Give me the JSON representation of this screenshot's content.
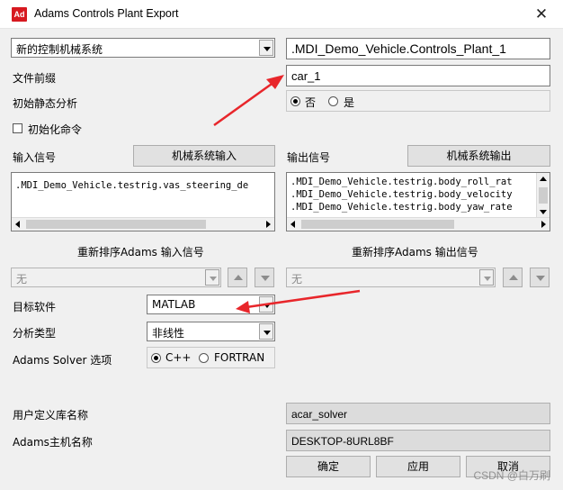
{
  "window": {
    "title": "Adams Controls Plant Export",
    "icon_text": "Ad",
    "close_glyph": "✕"
  },
  "plant_select": {
    "value": "新的控制机械系统"
  },
  "plant_name": {
    "value": ".MDI_Demo_Vehicle.Controls_Plant_1"
  },
  "file_prefix": {
    "label": "文件前缀",
    "value": "car_1"
  },
  "initial_static": {
    "label": "初始静态分析",
    "options": [
      "否",
      "是"
    ],
    "selected": "否"
  },
  "init_command": {
    "label": "初始化命令",
    "checked": false
  },
  "inputs": {
    "label": "输入信号",
    "button_label": "机械系统输入",
    "items": [
      ".MDI_Demo_Vehicle.testrig.vas_steering_de"
    ],
    "reorder_label": "重新排序Adams 输入信号",
    "reorder_value": "无"
  },
  "outputs": {
    "label": "输出信号",
    "button_label": "机械系统输出",
    "items": [
      ".MDI_Demo_Vehicle.testrig.body_roll_rat",
      ".MDI_Demo_Vehicle.testrig.body_velocity",
      ".MDI_Demo_Vehicle.testrig.body_yaw_rate"
    ],
    "reorder_label": "重新排序Adams 输出信号",
    "reorder_value": "无"
  },
  "target_software": {
    "label": "目标软件",
    "value": "MATLAB"
  },
  "analysis_type": {
    "label": "分析类型",
    "value": "非线性"
  },
  "solver": {
    "label": "Adams Solver 选项",
    "options": [
      "C++",
      "FORTRAN"
    ],
    "selected": "C++"
  },
  "user_lib": {
    "label": "用户定义库名称",
    "value": "acar_solver"
  },
  "host": {
    "label": "Adams主机名称",
    "value": "DESKTOP-8URL8BF"
  },
  "buttons": {
    "ok": "确定",
    "apply": "应用",
    "cancel": "取消"
  },
  "watermark": "CSDN @白万刷",
  "colors": {
    "annotation_arrow": "#e8262b",
    "icon_bg": "#d71920"
  }
}
